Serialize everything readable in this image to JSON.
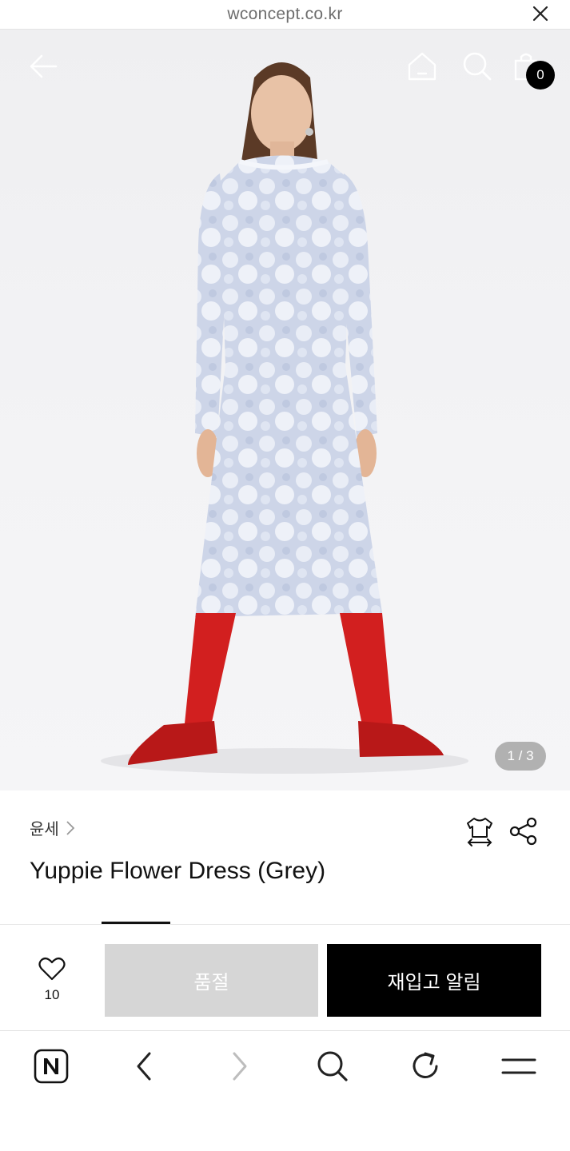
{
  "browser": {
    "url": "wconcept.co.kr",
    "close_icon": "close-icon"
  },
  "header": {
    "back_icon": "back-arrow-icon",
    "home_icon": "home-icon",
    "search_icon": "search-icon",
    "cart_icon": "shopping-bag-icon",
    "cart_count": "0"
  },
  "gallery": {
    "indicator": "1 / 3"
  },
  "product": {
    "brand": "윤세",
    "title": "Yuppie Flower Dress (Grey)",
    "size_guide_icon": "size-guide-icon",
    "share_icon": "share-icon"
  },
  "purchase": {
    "wish_icon": "heart-icon",
    "wish_count": "10",
    "soldout_label": "품절",
    "restock_label": "재입고 알림"
  },
  "toolbar": {
    "items": [
      "naver-n-icon",
      "back-chevron-icon",
      "forward-chevron-icon",
      "search-icon",
      "refresh-icon",
      "menu-icon"
    ]
  },
  "colors": {
    "accent": "#000000",
    "soldout_bg": "#d6d6d6",
    "tights": "#d21f1f"
  }
}
